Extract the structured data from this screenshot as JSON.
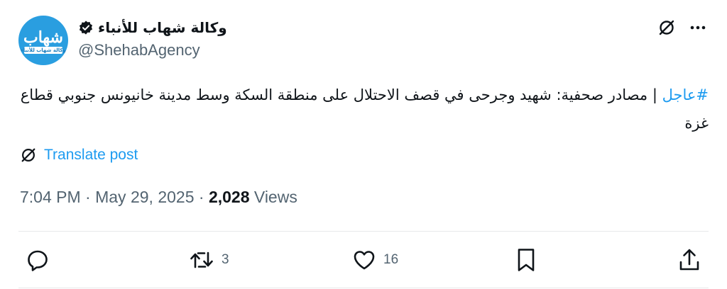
{
  "author": {
    "display_name": "وكالة شهاب للأنباء",
    "handle": "@ShehabAgency",
    "avatar_logo_text": "شهاب",
    "avatar_logo_subtext": "وكالة شهاب للأنباء",
    "verified_icon": "verified-badge-icon"
  },
  "tweet": {
    "hashtag": "#عاجل",
    "body": " | مصادر صحفية: شهيد وجرحى في قصف الاحتلال على منطقة السكة وسط مدينة خانيونس جنوبي قطاع غزة",
    "translate_label": "Translate post"
  },
  "meta": {
    "time": "7:04 PM",
    "separator": "·",
    "date": "May 29, 2025",
    "views_count": "2,028",
    "views_label": "Views"
  },
  "actions": {
    "reply_count": "",
    "retweet_count": "3",
    "like_count": "16"
  },
  "colors": {
    "accent": "#1d9bf0",
    "secondary_text": "#536471",
    "primary_text": "#0f1419",
    "divider": "#e7e9ea",
    "avatar_bg": "#2a9ee0"
  }
}
